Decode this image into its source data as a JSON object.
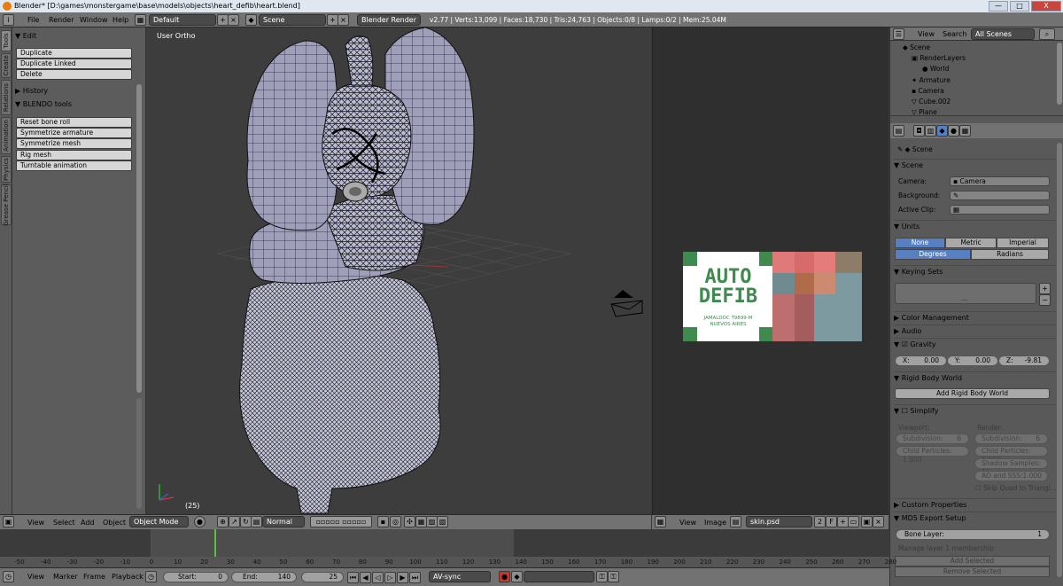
{
  "window": {
    "title": "Blender* [D:\\games\\monstergame\\base\\models\\objects\\heart_defib\\heart.blend]",
    "buttons": [
      "—",
      "□",
      "X"
    ]
  },
  "topbar": {
    "menus": [
      "File",
      "Render",
      "Window",
      "Help"
    ],
    "layout": "Default",
    "scene": "Scene",
    "engine": "Blender Render",
    "stats": "v2.77 | Verts:13,099 | Faces:18,730 | Tris:24,763 | Objects:0/8 | Lamps:0/2 | Mem:25.04M"
  },
  "tool_tabs": [
    "Tools",
    "Create",
    "Relations",
    "Animation",
    "Physics",
    "Grease Pencil"
  ],
  "tool_panel": {
    "edit_header": "Edit",
    "edit_buttons": [
      "Duplicate",
      "Duplicate Linked",
      "Delete"
    ],
    "history_header": "History",
    "blendo_header": "BLENDO tools",
    "blendo_buttons": [
      "Reset bone roll",
      "Symmetrize armature",
      "Symmetrize mesh",
      "Rig mesh",
      "Turntable animation"
    ]
  },
  "viewport": {
    "label": "User Ortho",
    "frame": "(25)",
    "header": {
      "menus": [
        "View",
        "Select",
        "Add",
        "Object"
      ],
      "mode": "Object Mode",
      "pivot": "Normal"
    }
  },
  "image_editor": {
    "header": {
      "menus": [
        "View",
        "Image"
      ],
      "image_name": "skin.psd",
      "users": "2",
      "fake": "F"
    },
    "label": {
      "title_line1": "AUTO",
      "title_line2": "DEFIB",
      "subtitle_line1": "JAMALDOC T9899-M",
      "subtitle_line2": "NUEVOS AIRES"
    },
    "colors": {
      "accent_green": "#3f8a4e",
      "pink": "#d76b6b",
      "grey_blue": "#7d9aa0"
    }
  },
  "outliner": {
    "menus": [
      "View",
      "Search"
    ],
    "filter": "All Scenes",
    "items": [
      "Scene",
      "RenderLayers",
      "World",
      "Armature",
      "Camera",
      "Cube.002",
      "Plane"
    ]
  },
  "properties": {
    "breadcrumb": "Scene",
    "scene_section": "Scene",
    "camera_label": "Camera:",
    "camera_value": "Camera",
    "background_label": "Background:",
    "active_clip_label": "Active Clip:",
    "units_section": "Units",
    "unit_buttons": [
      "None",
      "Metric",
      "Imperial"
    ],
    "rotation_buttons": [
      "Degrees",
      "Radians"
    ],
    "keying_section": "Keying Sets",
    "color_mgmt": "Color Management",
    "audio": "Audio",
    "gravity": "Gravity",
    "gravity_x": "X:",
    "gravity_x_val": "0.00",
    "gravity_y": "Y:",
    "gravity_y_val": "0.00",
    "gravity_z": "Z:",
    "gravity_z_val": "-9.81",
    "rigid_body": "Rigid Body World",
    "add_rigid": "Add Rigid Body World",
    "simplify": "Simplify",
    "viewport_label": "Viewport:",
    "render_label": "Render:",
    "subdivision": "Subdivision:",
    "subdivision_val": "6",
    "child_particles": "Child Particles: 1.000",
    "shadow_samples": "Shadow Samples: 16",
    "ao_sss": "AO and SSS:",
    "ao_sss_val": "1.000",
    "skip_quad": "Skip Quad to Triangl...",
    "custom_props": "Custom Properties",
    "md5": "MD5 Export Setup",
    "bone_layer": "Bone Layer:",
    "bone_layer_val": "1",
    "manage_layer": "Manage layer 1 membership:",
    "add_selected": "Add Selected",
    "remove_selected": "Remove Selected",
    "dash": "—"
  },
  "timeline": {
    "ticks": [
      "-50",
      "-40",
      "-30",
      "-20",
      "-10",
      "0",
      "10",
      "20",
      "30",
      "40",
      "50",
      "60",
      "70",
      "80",
      "90",
      "100",
      "110",
      "120",
      "130",
      "140",
      "150",
      "160",
      "170",
      "180",
      "190",
      "200",
      "210",
      "220",
      "230",
      "240",
      "250",
      "260",
      "270",
      "280"
    ],
    "current_frame": 25,
    "header": {
      "menus": [
        "View",
        "Marker",
        "Frame",
        "Playback"
      ],
      "start_label": "Start:",
      "start": "0",
      "end_label": "End:",
      "end": "140",
      "current": "25",
      "sync": "AV-sync"
    }
  }
}
